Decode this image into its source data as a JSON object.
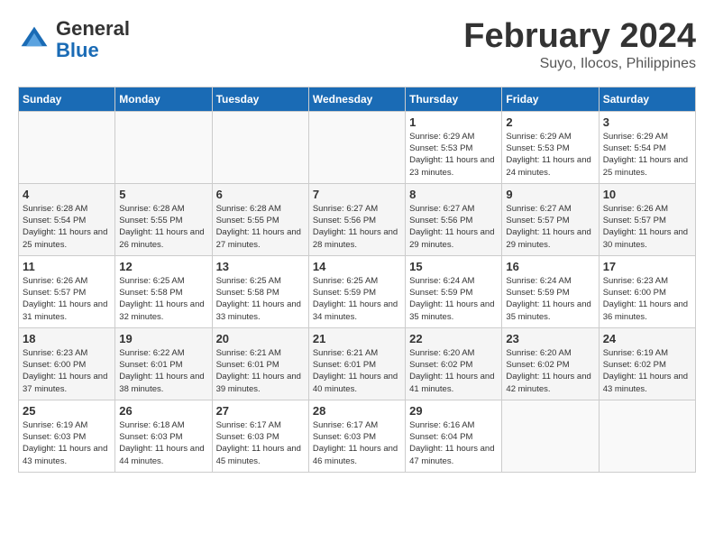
{
  "header": {
    "logo_line1": "General",
    "logo_line2": "Blue",
    "month_year": "February 2024",
    "location": "Suyo, Ilocos, Philippines"
  },
  "days_of_week": [
    "Sunday",
    "Monday",
    "Tuesday",
    "Wednesday",
    "Thursday",
    "Friday",
    "Saturday"
  ],
  "weeks": [
    [
      {
        "day": "",
        "info": ""
      },
      {
        "day": "",
        "info": ""
      },
      {
        "day": "",
        "info": ""
      },
      {
        "day": "",
        "info": ""
      },
      {
        "day": "1",
        "info": "Sunrise: 6:29 AM\nSunset: 5:53 PM\nDaylight: 11 hours and 23 minutes."
      },
      {
        "day": "2",
        "info": "Sunrise: 6:29 AM\nSunset: 5:53 PM\nDaylight: 11 hours and 24 minutes."
      },
      {
        "day": "3",
        "info": "Sunrise: 6:29 AM\nSunset: 5:54 PM\nDaylight: 11 hours and 25 minutes."
      }
    ],
    [
      {
        "day": "4",
        "info": "Sunrise: 6:28 AM\nSunset: 5:54 PM\nDaylight: 11 hours and 25 minutes."
      },
      {
        "day": "5",
        "info": "Sunrise: 6:28 AM\nSunset: 5:55 PM\nDaylight: 11 hours and 26 minutes."
      },
      {
        "day": "6",
        "info": "Sunrise: 6:28 AM\nSunset: 5:55 PM\nDaylight: 11 hours and 27 minutes."
      },
      {
        "day": "7",
        "info": "Sunrise: 6:27 AM\nSunset: 5:56 PM\nDaylight: 11 hours and 28 minutes."
      },
      {
        "day": "8",
        "info": "Sunrise: 6:27 AM\nSunset: 5:56 PM\nDaylight: 11 hours and 29 minutes."
      },
      {
        "day": "9",
        "info": "Sunrise: 6:27 AM\nSunset: 5:57 PM\nDaylight: 11 hours and 29 minutes."
      },
      {
        "day": "10",
        "info": "Sunrise: 6:26 AM\nSunset: 5:57 PM\nDaylight: 11 hours and 30 minutes."
      }
    ],
    [
      {
        "day": "11",
        "info": "Sunrise: 6:26 AM\nSunset: 5:57 PM\nDaylight: 11 hours and 31 minutes."
      },
      {
        "day": "12",
        "info": "Sunrise: 6:25 AM\nSunset: 5:58 PM\nDaylight: 11 hours and 32 minutes."
      },
      {
        "day": "13",
        "info": "Sunrise: 6:25 AM\nSunset: 5:58 PM\nDaylight: 11 hours and 33 minutes."
      },
      {
        "day": "14",
        "info": "Sunrise: 6:25 AM\nSunset: 5:59 PM\nDaylight: 11 hours and 34 minutes."
      },
      {
        "day": "15",
        "info": "Sunrise: 6:24 AM\nSunset: 5:59 PM\nDaylight: 11 hours and 35 minutes."
      },
      {
        "day": "16",
        "info": "Sunrise: 6:24 AM\nSunset: 5:59 PM\nDaylight: 11 hours and 35 minutes."
      },
      {
        "day": "17",
        "info": "Sunrise: 6:23 AM\nSunset: 6:00 PM\nDaylight: 11 hours and 36 minutes."
      }
    ],
    [
      {
        "day": "18",
        "info": "Sunrise: 6:23 AM\nSunset: 6:00 PM\nDaylight: 11 hours and 37 minutes."
      },
      {
        "day": "19",
        "info": "Sunrise: 6:22 AM\nSunset: 6:01 PM\nDaylight: 11 hours and 38 minutes."
      },
      {
        "day": "20",
        "info": "Sunrise: 6:21 AM\nSunset: 6:01 PM\nDaylight: 11 hours and 39 minutes."
      },
      {
        "day": "21",
        "info": "Sunrise: 6:21 AM\nSunset: 6:01 PM\nDaylight: 11 hours and 40 minutes."
      },
      {
        "day": "22",
        "info": "Sunrise: 6:20 AM\nSunset: 6:02 PM\nDaylight: 11 hours and 41 minutes."
      },
      {
        "day": "23",
        "info": "Sunrise: 6:20 AM\nSunset: 6:02 PM\nDaylight: 11 hours and 42 minutes."
      },
      {
        "day": "24",
        "info": "Sunrise: 6:19 AM\nSunset: 6:02 PM\nDaylight: 11 hours and 43 minutes."
      }
    ],
    [
      {
        "day": "25",
        "info": "Sunrise: 6:19 AM\nSunset: 6:03 PM\nDaylight: 11 hours and 43 minutes."
      },
      {
        "day": "26",
        "info": "Sunrise: 6:18 AM\nSunset: 6:03 PM\nDaylight: 11 hours and 44 minutes."
      },
      {
        "day": "27",
        "info": "Sunrise: 6:17 AM\nSunset: 6:03 PM\nDaylight: 11 hours and 45 minutes."
      },
      {
        "day": "28",
        "info": "Sunrise: 6:17 AM\nSunset: 6:03 PM\nDaylight: 11 hours and 46 minutes."
      },
      {
        "day": "29",
        "info": "Sunrise: 6:16 AM\nSunset: 6:04 PM\nDaylight: 11 hours and 47 minutes."
      },
      {
        "day": "",
        "info": ""
      },
      {
        "day": "",
        "info": ""
      }
    ]
  ]
}
